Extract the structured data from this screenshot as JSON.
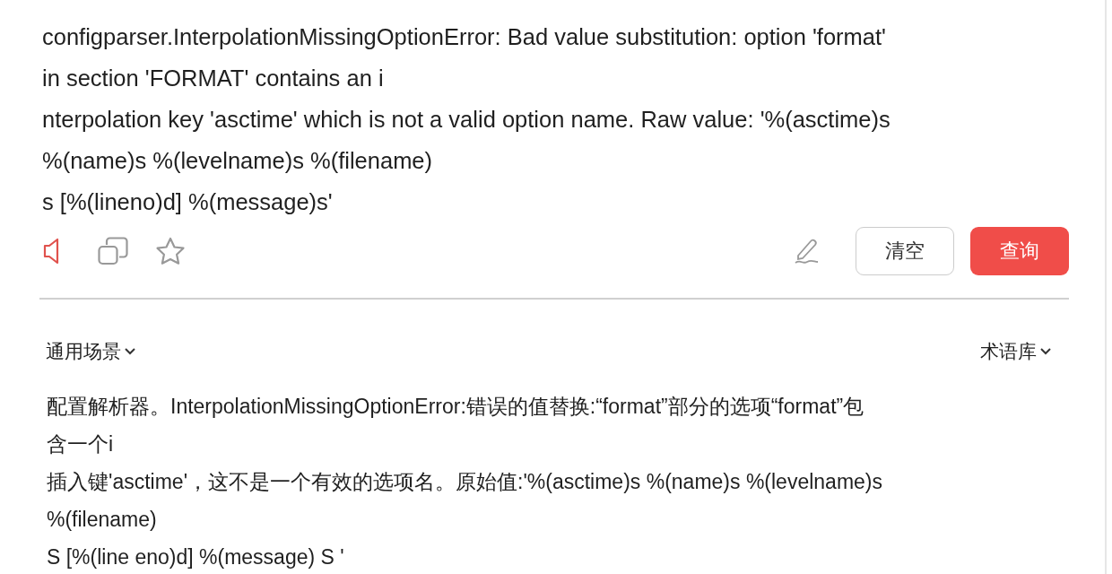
{
  "source": {
    "lines": [
      "configparser.InterpolationMissingOptionError: Bad value substitution: option 'format'",
      "in section 'FORMAT' contains an i",
      "nterpolation key 'asctime' which is not a valid option name. Raw value: '%(asctime)s",
      "%(name)s %(levelname)s %(filename)",
      "s [%(lineno)d] %(message)s'"
    ]
  },
  "actions": {
    "clear": "清空",
    "query": "查询"
  },
  "scene": {
    "label": "通用场景"
  },
  "glossary": {
    "label": "术语库"
  },
  "translation": {
    "lines": [
      "配置解析器。InterpolationMissingOptionError:错误的值替换:“format”部分的选项“format”包",
      "含一个i",
      "插入键'asctime'，这不是一个有效的选项名。原始值:'%(asctime)s %(name)s %(levelname)s",
      "%(filename)",
      "S [%(line eno)d] %(message) S '"
    ]
  }
}
